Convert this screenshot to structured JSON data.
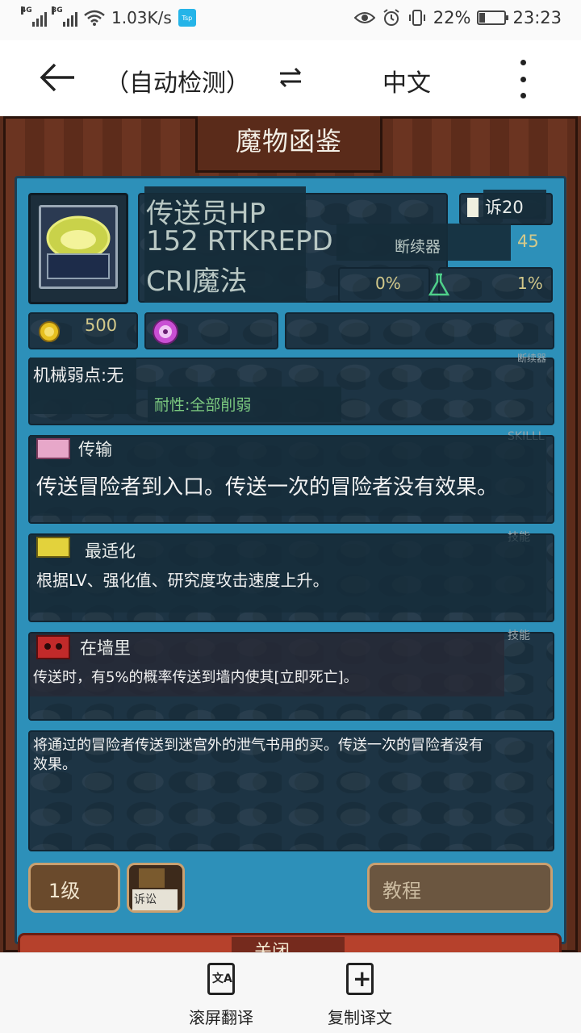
{
  "status_bar": {
    "sig1_tag": "4G",
    "sig2_tag": "3G",
    "net_speed": "1.03K/s",
    "app_badge": "Tsp",
    "battery_percent": "22%",
    "battery_level": 0.22,
    "time": "23:23"
  },
  "toolbar": {
    "source_lang": "（自动检测）",
    "target_lang": "中文"
  },
  "game": {
    "title": "魔物函鉴",
    "monster_name": "传送员HP",
    "stat_line": "152 RTKREPD",
    "type_line": "CRI魔法",
    "badge_text": "诉20",
    "breaker_label": "断续器",
    "breaker_value": "45",
    "percent_left": "0%",
    "percent_right": "1%",
    "gold_value": "500",
    "breaker_small": "断续器",
    "weakness": "机械弱点:无",
    "resistance": "耐性:全部削弱",
    "skill_header1": "SKILLL",
    "skill1_name": "传输",
    "skill1_desc": "传送冒险者到入口。传送一次的冒险者没有效果。",
    "skill_header2": "技能",
    "skill2_name": "最适化",
    "skill2_desc": "根据LV、强化值、研究度攻击速度上升。",
    "skill_header3": "技能",
    "skill3_name": "在墙里",
    "skill3_desc": "传送时，有5%的概率传送到墙内使其[立即死亡]。",
    "description_line1": "将通过的冒险者传送到迷宫外的泄气书用的买。传送一次的冒险者没有",
    "description_line2": "效果。",
    "level_button": "1级",
    "lawsuit_label": "诉讼",
    "tutorial_button": "教程",
    "close_button": "关闭"
  },
  "bottom_bar": {
    "scroll_translate": "滚屏翻译",
    "copy_translation": "复制译文"
  },
  "colors": {
    "panel_blue": "#2d90b9",
    "stone": "#1d3444",
    "wood": "#6b3421",
    "green_text": "#7bc87f"
  }
}
